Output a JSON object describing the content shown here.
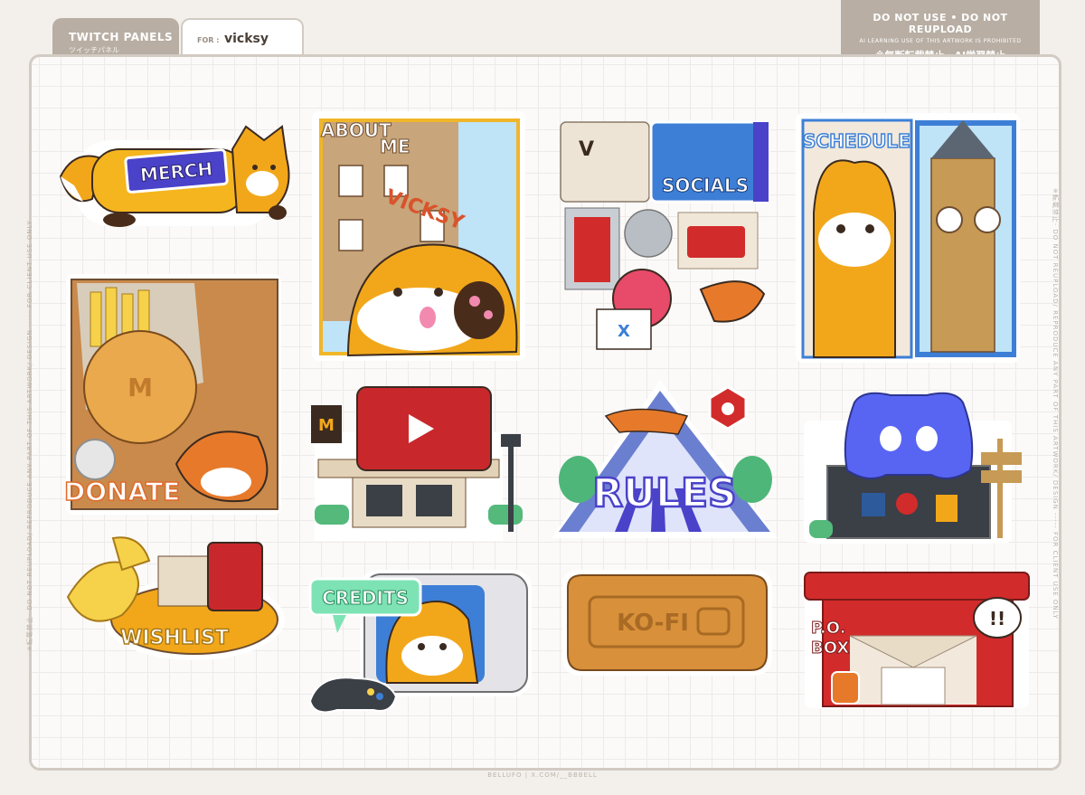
{
  "header": {
    "tab_title": "TWITCH PANELS",
    "tab_subtitle": "ツイッチパネル",
    "for_label": "FOR :",
    "for_value": "vicksy"
  },
  "notice": {
    "line1": "DO NOT USE • DO NOT REUPLOAD",
    "line2": "AI LEARNING USE OF THIS ARTWORK IS PROHIBITED",
    "line3": "※無断転載禁止・AI学習禁止"
  },
  "side_text_left": "※転載禁止· DO NOT REUPLOAD/ REPRODUCE ANY PART OF THIS ARTWORK/ DESIGN ----- FOR CLIENT USE ONLY",
  "side_text_right": "※転載禁止· DO NOT REUPLOAD/ REPRODUCE ANY PART OF THIS ARTWORK/ DESIGN ----- FOR CLIENT USE ONLY",
  "footer": "BELLUFO | X.COM/__BBBELL",
  "panels": {
    "merch": "MERCH",
    "about_1": "ABOUT",
    "about_2": "ME",
    "about_sign": "VICKSY",
    "socials": "SOCIALS",
    "schedule": "SCHEDULE",
    "donate": "DONATE",
    "rules": "RULES",
    "wishlist": "WISHLIST",
    "credits": "CREDITS",
    "kofi": "KO-FI",
    "pobox_1": "P.O.",
    "pobox_2": "BOX",
    "pobox_bubble": "!!"
  },
  "colors": {
    "fox_orange": "#f2a71b",
    "panel_blue": "#3d7fd6",
    "discord": "#5865f2",
    "youtube": "#c8282c",
    "postbox": "#d22b2b"
  }
}
